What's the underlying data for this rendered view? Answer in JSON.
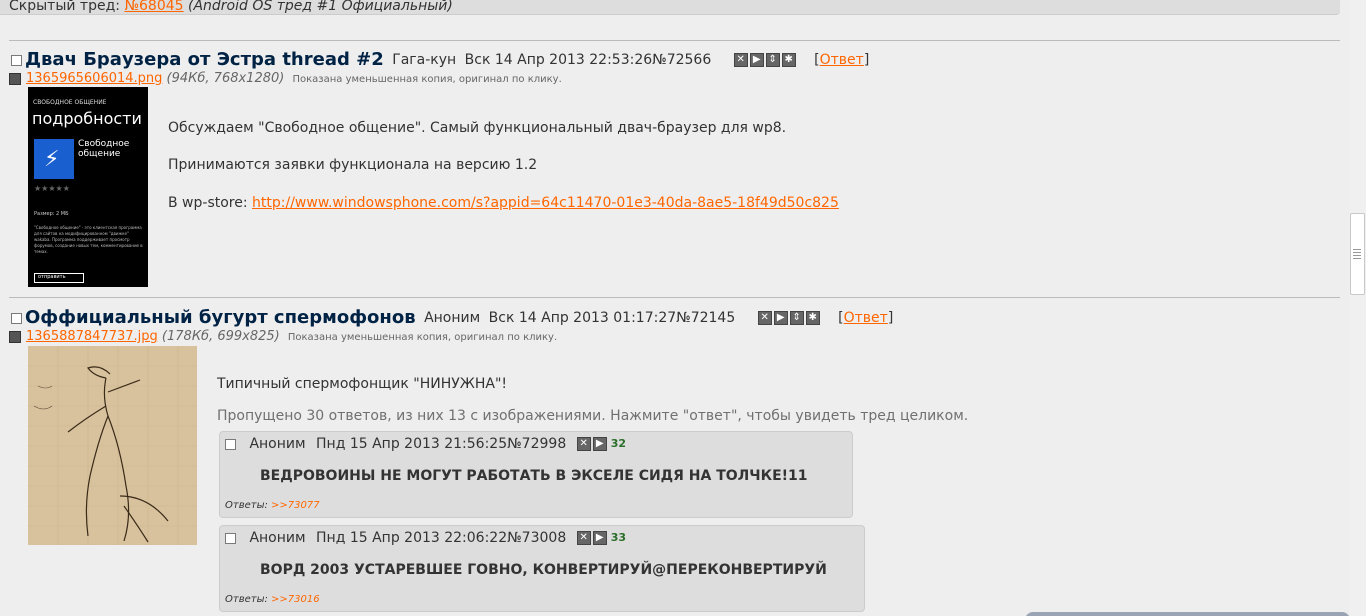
{
  "hidden_thread": {
    "label": "Скрытый тред:",
    "link": "№68045",
    "title": "(Android OS тред #1 Официальный)"
  },
  "threads": [
    {
      "subject": "Двач Браузера от Эстра thread #2",
      "author": "Гага-кун",
      "date": "Вск 14 Апр 2013 22:53:26",
      "number": "№72566",
      "reply_open": "[",
      "reply_label": "Ответ",
      "reply_close": "]",
      "file_name": "1365965606014.png",
      "file_info_open": " (",
      "file_size": "94Кб, 768x1280",
      "file_info_close": ")",
      "file_note": "Показана уменьшенная копия, оригинал по клику.",
      "thumb": {
        "header": "СВОБОДНОЕ ОБЩЕНИЕ",
        "big": "подробности",
        "app_name_1": "Свободное",
        "app_name_2": "общение",
        "size": "Размер: 2 МБ",
        "desc": "\"Свободное общение\" - это клиентская программа для сайтов на модифицированном \"движке\" wakaba. Программа поддерживает просмотр форумов, создание новых тем, комментирование в темах.",
        "button": "отправить"
      },
      "body": [
        "Обсуждаем \"Свободное общение\". Самый функциональный двач-браузер для wp8.",
        "Принимаются заявки функционала на версию 1.2"
      ],
      "store_label": "В wp-store: ",
      "store_link": "http://www.windowsphone.com/s?appid=64c11470-01e3-40da-8ae5-18f49d50c825"
    },
    {
      "subject": "Оффициальный бугурт спермофонов",
      "author": "Аноним",
      "date": "Вск 14 Апр 2013 01:17:27",
      "number": "№72145",
      "reply_open": "[",
      "reply_label": "Ответ",
      "reply_close": "]",
      "file_name": "1365887847737.jpg",
      "file_info_open": " (",
      "file_size": "178Кб, 699x825",
      "file_info_close": ")",
      "file_note": "Показана уменьшенная копия, оригинал по клику.",
      "body": "Типичный спермофонщик \"НИНУЖНА\"!",
      "omitted": "Пропущено 30 ответов, из них 13 с изображениями. Нажмите \"ответ\", чтобы увидеть тред целиком.",
      "replies": [
        {
          "author": "Аноним",
          "date": "Пнд 15 Апр 2013 21:56:25",
          "number": "№72998",
          "index": "32",
          "text": "ВЕДРОВОИНЫ НЕ МОГУТ РАБОТАТЬ В ЭКСЕЛЕ СИДЯ НА ТОЛЧКЕ!11",
          "refs_label": "Ответы: ",
          "refs_link": ">>73077"
        },
        {
          "author": "Аноним",
          "date": "Пнд 15 Апр 2013 22:06:22",
          "number": "№73008",
          "index": "33",
          "text": "ВОРД 2003 УСТАРЕВШЕЕ ГОВНО, КОНВЕРТИРУЙ@ПЕРЕКОНВЕРТИРУЙ",
          "refs_label": "Ответы: ",
          "refs_link": ">>73016"
        }
      ]
    }
  ],
  "icons": {
    "hide": "close-icon",
    "play": "play-icon",
    "expand": "expand-icon",
    "report": "report-icon",
    "save": "save-icon"
  },
  "colors": {
    "link": "#ff6600",
    "subject": "#002244",
    "reply_bg": "#dddddd",
    "page_bg": "#eeeeee",
    "index_badge": "#2a6e2a"
  }
}
